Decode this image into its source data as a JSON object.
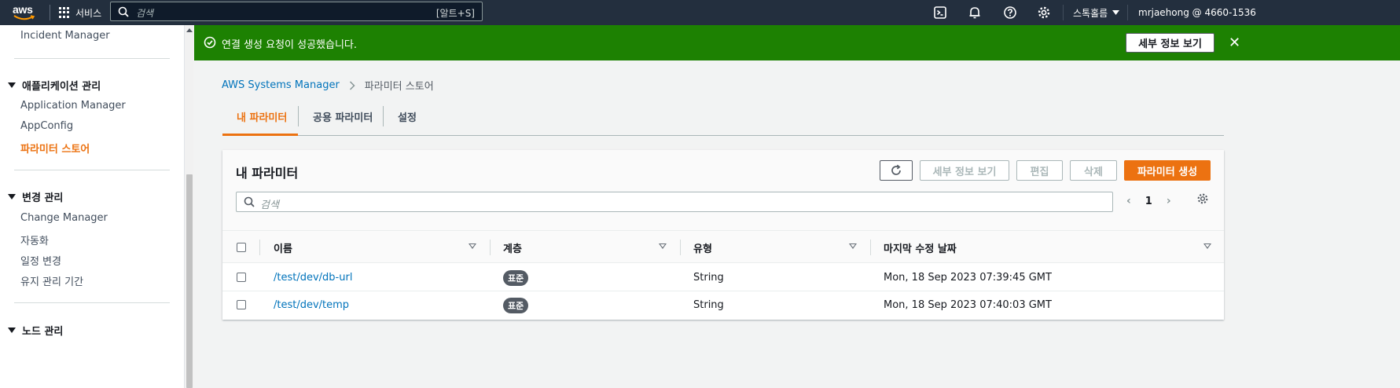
{
  "topnav": {
    "logo": "aws",
    "services_label": "서비스",
    "search_placeholder": "검색",
    "search_shortcut": "[알트+S]",
    "region_label": "스톡홀름",
    "account_label": "mrjaehong @ 4660-1536"
  },
  "sidebar": {
    "top_item": "Incident Manager",
    "sections": [
      {
        "title": "애플리케이션 관리",
        "items": [
          "Application Manager",
          "AppConfig",
          "파라미터 스토어"
        ]
      },
      {
        "title": "변경 관리",
        "items": [
          "Change Manager",
          "자동화",
          "일정 변경",
          "유지 관리 기간"
        ]
      },
      {
        "title": "노드 관리",
        "items": []
      }
    ],
    "active_item": "파라미터 스토어"
  },
  "flash": {
    "message": "연결 생성 요청이 성공했습니다.",
    "button_label": "세부 정보 보기",
    "close_symbol": "✕"
  },
  "breadcrumb": {
    "root": "AWS Systems Manager",
    "current": "파라미터 스토어"
  },
  "tabs": [
    "내 파라미터",
    "공용 파라미터",
    "설정"
  ],
  "panel": {
    "title": "내 파라미터",
    "buttons": {
      "details": "세부 정보 보기",
      "edit": "편집",
      "delete": "삭제",
      "create": "파라미터 생성"
    },
    "filter_placeholder": "검색",
    "page_number": "1",
    "prev_symbol": "‹",
    "next_symbol": "›"
  },
  "table": {
    "columns": [
      "이름",
      "계층",
      "유형",
      "마지막 수정 날짜"
    ],
    "rows": [
      {
        "name": "/test/dev/db-url",
        "tier": "표준",
        "type": "String",
        "modified": "Mon, 18 Sep 2023 07:39:45 GMT"
      },
      {
        "name": "/test/dev/temp",
        "tier": "표준",
        "type": "String",
        "modified": "Mon, 18 Sep 2023 07:40:03 GMT"
      }
    ]
  },
  "colors": {
    "nav_bg": "#232f3e",
    "accent": "#ec7211",
    "success": "#1d8102",
    "link": "#0073bb"
  }
}
